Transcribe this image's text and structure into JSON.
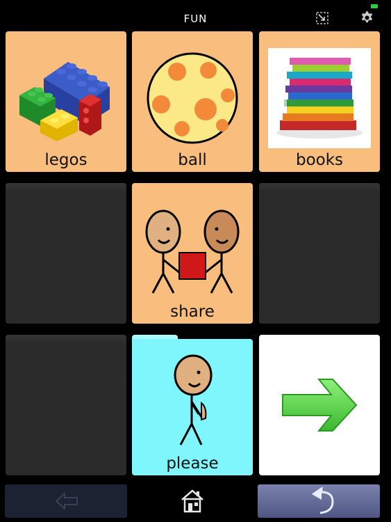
{
  "header": {
    "title": "FUN"
  },
  "cells": [
    {
      "label": "legos"
    },
    {
      "label": "ball"
    },
    {
      "label": "books"
    },
    {
      "label": ""
    },
    {
      "label": "share"
    },
    {
      "label": ""
    },
    {
      "label": ""
    },
    {
      "label": "please"
    },
    {
      "label": ""
    }
  ],
  "icons": {
    "expand": "expand-icon",
    "settings": "gear-icon",
    "back": "back-arrow-icon",
    "home": "home-icon",
    "undo": "undo-icon",
    "next": "next-page-arrow-icon"
  },
  "colors": {
    "cell_orange": "#f9be7e",
    "folder_cyan": "#7ff6fb",
    "arrow_green": "#5fd14a"
  }
}
